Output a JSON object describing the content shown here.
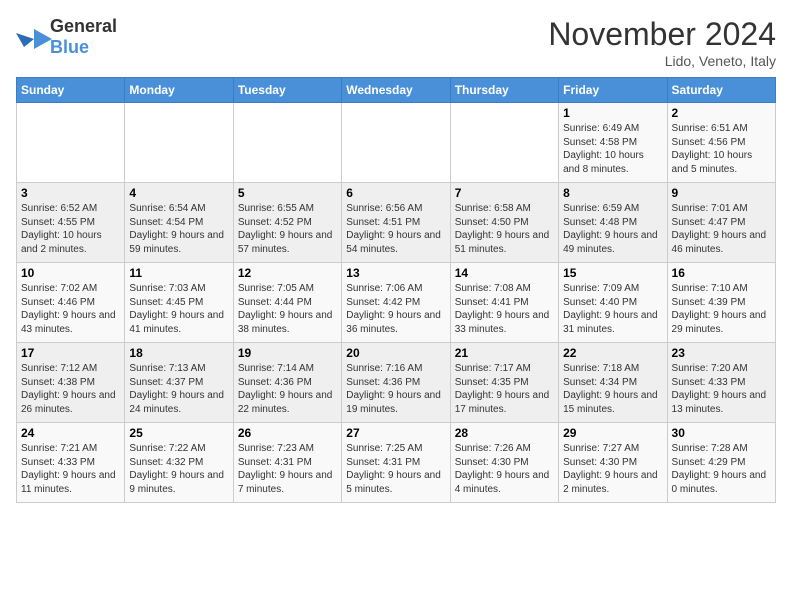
{
  "header": {
    "logo_general": "General",
    "logo_blue": "Blue",
    "title": "November 2024",
    "location": "Lido, Veneto, Italy"
  },
  "weekdays": [
    "Sunday",
    "Monday",
    "Tuesday",
    "Wednesday",
    "Thursday",
    "Friday",
    "Saturday"
  ],
  "weeks": [
    [
      {
        "day": "",
        "info": ""
      },
      {
        "day": "",
        "info": ""
      },
      {
        "day": "",
        "info": ""
      },
      {
        "day": "",
        "info": ""
      },
      {
        "day": "",
        "info": ""
      },
      {
        "day": "1",
        "info": "Sunrise: 6:49 AM\nSunset: 4:58 PM\nDaylight: 10 hours and 8 minutes."
      },
      {
        "day": "2",
        "info": "Sunrise: 6:51 AM\nSunset: 4:56 PM\nDaylight: 10 hours and 5 minutes."
      }
    ],
    [
      {
        "day": "3",
        "info": "Sunrise: 6:52 AM\nSunset: 4:55 PM\nDaylight: 10 hours and 2 minutes."
      },
      {
        "day": "4",
        "info": "Sunrise: 6:54 AM\nSunset: 4:54 PM\nDaylight: 9 hours and 59 minutes."
      },
      {
        "day": "5",
        "info": "Sunrise: 6:55 AM\nSunset: 4:52 PM\nDaylight: 9 hours and 57 minutes."
      },
      {
        "day": "6",
        "info": "Sunrise: 6:56 AM\nSunset: 4:51 PM\nDaylight: 9 hours and 54 minutes."
      },
      {
        "day": "7",
        "info": "Sunrise: 6:58 AM\nSunset: 4:50 PM\nDaylight: 9 hours and 51 minutes."
      },
      {
        "day": "8",
        "info": "Sunrise: 6:59 AM\nSunset: 4:48 PM\nDaylight: 9 hours and 49 minutes."
      },
      {
        "day": "9",
        "info": "Sunrise: 7:01 AM\nSunset: 4:47 PM\nDaylight: 9 hours and 46 minutes."
      }
    ],
    [
      {
        "day": "10",
        "info": "Sunrise: 7:02 AM\nSunset: 4:46 PM\nDaylight: 9 hours and 43 minutes."
      },
      {
        "day": "11",
        "info": "Sunrise: 7:03 AM\nSunset: 4:45 PM\nDaylight: 9 hours and 41 minutes."
      },
      {
        "day": "12",
        "info": "Sunrise: 7:05 AM\nSunset: 4:44 PM\nDaylight: 9 hours and 38 minutes."
      },
      {
        "day": "13",
        "info": "Sunrise: 7:06 AM\nSunset: 4:42 PM\nDaylight: 9 hours and 36 minutes."
      },
      {
        "day": "14",
        "info": "Sunrise: 7:08 AM\nSunset: 4:41 PM\nDaylight: 9 hours and 33 minutes."
      },
      {
        "day": "15",
        "info": "Sunrise: 7:09 AM\nSunset: 4:40 PM\nDaylight: 9 hours and 31 minutes."
      },
      {
        "day": "16",
        "info": "Sunrise: 7:10 AM\nSunset: 4:39 PM\nDaylight: 9 hours and 29 minutes."
      }
    ],
    [
      {
        "day": "17",
        "info": "Sunrise: 7:12 AM\nSunset: 4:38 PM\nDaylight: 9 hours and 26 minutes."
      },
      {
        "day": "18",
        "info": "Sunrise: 7:13 AM\nSunset: 4:37 PM\nDaylight: 9 hours and 24 minutes."
      },
      {
        "day": "19",
        "info": "Sunrise: 7:14 AM\nSunset: 4:36 PM\nDaylight: 9 hours and 22 minutes."
      },
      {
        "day": "20",
        "info": "Sunrise: 7:16 AM\nSunset: 4:36 PM\nDaylight: 9 hours and 19 minutes."
      },
      {
        "day": "21",
        "info": "Sunrise: 7:17 AM\nSunset: 4:35 PM\nDaylight: 9 hours and 17 minutes."
      },
      {
        "day": "22",
        "info": "Sunrise: 7:18 AM\nSunset: 4:34 PM\nDaylight: 9 hours and 15 minutes."
      },
      {
        "day": "23",
        "info": "Sunrise: 7:20 AM\nSunset: 4:33 PM\nDaylight: 9 hours and 13 minutes."
      }
    ],
    [
      {
        "day": "24",
        "info": "Sunrise: 7:21 AM\nSunset: 4:33 PM\nDaylight: 9 hours and 11 minutes."
      },
      {
        "day": "25",
        "info": "Sunrise: 7:22 AM\nSunset: 4:32 PM\nDaylight: 9 hours and 9 minutes."
      },
      {
        "day": "26",
        "info": "Sunrise: 7:23 AM\nSunset: 4:31 PM\nDaylight: 9 hours and 7 minutes."
      },
      {
        "day": "27",
        "info": "Sunrise: 7:25 AM\nSunset: 4:31 PM\nDaylight: 9 hours and 5 minutes."
      },
      {
        "day": "28",
        "info": "Sunrise: 7:26 AM\nSunset: 4:30 PM\nDaylight: 9 hours and 4 minutes."
      },
      {
        "day": "29",
        "info": "Sunrise: 7:27 AM\nSunset: 4:30 PM\nDaylight: 9 hours and 2 minutes."
      },
      {
        "day": "30",
        "info": "Sunrise: 7:28 AM\nSunset: 4:29 PM\nDaylight: 9 hours and 0 minutes."
      }
    ]
  ]
}
